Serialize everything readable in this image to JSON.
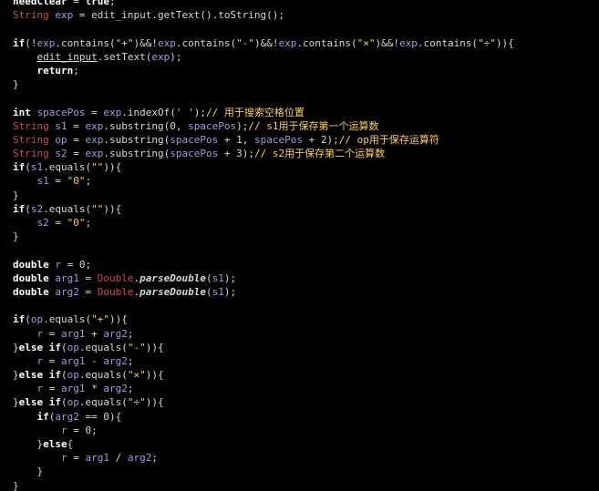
{
  "editor": {
    "lines": [
      [
        {
          "t": "kw",
          "v": "needClear"
        },
        {
          "t": "plain",
          "v": " = "
        },
        {
          "t": "kw",
          "v": "true"
        },
        {
          "t": "plain",
          "v": ";"
        }
      ],
      [
        {
          "t": "type",
          "v": "String"
        },
        {
          "t": "plain",
          "v": " "
        },
        {
          "t": "var",
          "v": "exp"
        },
        {
          "t": "plain",
          "v": " = edit_input.getText().toString();"
        }
      ],
      [],
      [
        {
          "t": "kw",
          "v": "if"
        },
        {
          "t": "plain",
          "v": "(!"
        },
        {
          "t": "var",
          "v": "exp"
        },
        {
          "t": "plain",
          "v": ".contains("
        },
        {
          "t": "str",
          "v": "\"+\""
        },
        {
          "t": "plain",
          "v": ")&&!"
        },
        {
          "t": "var",
          "v": "exp"
        },
        {
          "t": "plain",
          "v": ".contains("
        },
        {
          "t": "str",
          "v": "\"-\""
        },
        {
          "t": "plain",
          "v": ")&&!"
        },
        {
          "t": "var",
          "v": "exp"
        },
        {
          "t": "plain",
          "v": ".contains("
        },
        {
          "t": "str",
          "v": "\"×\""
        },
        {
          "t": "plain",
          "v": ")&&!"
        },
        {
          "t": "var",
          "v": "exp"
        },
        {
          "t": "plain",
          "v": ".contains("
        },
        {
          "t": "str",
          "v": "\"÷\""
        },
        {
          "t": "plain",
          "v": ")){"
        }
      ],
      [
        {
          "t": "plain",
          "v": "    "
        },
        {
          "t": "link",
          "v": "edit_input"
        },
        {
          "t": "plain",
          "v": ".setText("
        },
        {
          "t": "var",
          "v": "exp"
        },
        {
          "t": "plain",
          "v": ");"
        }
      ],
      [
        {
          "t": "plain",
          "v": "    "
        },
        {
          "t": "kw",
          "v": "return"
        },
        {
          "t": "plain",
          "v": ";"
        }
      ],
      [
        {
          "t": "plain",
          "v": "}"
        }
      ],
      [],
      [
        {
          "t": "kw",
          "v": "int"
        },
        {
          "t": "plain",
          "v": " "
        },
        {
          "t": "var",
          "v": "spacePos"
        },
        {
          "t": "plain",
          "v": " = "
        },
        {
          "t": "var",
          "v": "exp"
        },
        {
          "t": "plain",
          "v": ".indexOf("
        },
        {
          "t": "str",
          "v": "' '"
        },
        {
          "t": "plain",
          "v": ");"
        },
        {
          "t": "cmt",
          "v": "// 用于搜索空格位置"
        }
      ],
      [
        {
          "t": "type",
          "v": "String"
        },
        {
          "t": "plain",
          "v": " "
        },
        {
          "t": "var",
          "v": "s1"
        },
        {
          "t": "plain",
          "v": " = "
        },
        {
          "t": "var",
          "v": "exp"
        },
        {
          "t": "plain",
          "v": ".substring("
        },
        {
          "t": "num",
          "v": "0"
        },
        {
          "t": "plain",
          "v": ", "
        },
        {
          "t": "var",
          "v": "spacePos"
        },
        {
          "t": "plain",
          "v": ");"
        },
        {
          "t": "cmt",
          "v": "// s1用于保存第一个运算数"
        }
      ],
      [
        {
          "t": "type",
          "v": "String"
        },
        {
          "t": "plain",
          "v": " "
        },
        {
          "t": "var",
          "v": "op"
        },
        {
          "t": "plain",
          "v": " = "
        },
        {
          "t": "var",
          "v": "exp"
        },
        {
          "t": "plain",
          "v": ".substring("
        },
        {
          "t": "var",
          "v": "spacePos"
        },
        {
          "t": "plain",
          "v": " + "
        },
        {
          "t": "num",
          "v": "1"
        },
        {
          "t": "plain",
          "v": ", "
        },
        {
          "t": "var",
          "v": "spacePos"
        },
        {
          "t": "plain",
          "v": " + "
        },
        {
          "t": "num",
          "v": "2"
        },
        {
          "t": "plain",
          "v": ");"
        },
        {
          "t": "cmt",
          "v": "// op用于保存运算符"
        }
      ],
      [
        {
          "t": "type",
          "v": "String"
        },
        {
          "t": "plain",
          "v": " "
        },
        {
          "t": "var",
          "v": "s2"
        },
        {
          "t": "plain",
          "v": " = "
        },
        {
          "t": "var",
          "v": "exp"
        },
        {
          "t": "plain",
          "v": ".substring("
        },
        {
          "t": "var",
          "v": "spacePos"
        },
        {
          "t": "plain",
          "v": " + "
        },
        {
          "t": "num",
          "v": "3"
        },
        {
          "t": "plain",
          "v": ");"
        },
        {
          "t": "cmt",
          "v": "// s2用于保存第二个运算数"
        }
      ],
      [
        {
          "t": "kw",
          "v": "if"
        },
        {
          "t": "plain",
          "v": "("
        },
        {
          "t": "var",
          "v": "s1"
        },
        {
          "t": "plain",
          "v": ".equals("
        },
        {
          "t": "str",
          "v": "\"\""
        },
        {
          "t": "plain",
          "v": ")){"
        }
      ],
      [
        {
          "t": "plain",
          "v": "    "
        },
        {
          "t": "var",
          "v": "s1"
        },
        {
          "t": "plain",
          "v": " = "
        },
        {
          "t": "str",
          "v": "\"0\""
        },
        {
          "t": "plain",
          "v": ";"
        }
      ],
      [
        {
          "t": "plain",
          "v": "}"
        }
      ],
      [
        {
          "t": "kw",
          "v": "if"
        },
        {
          "t": "plain",
          "v": "("
        },
        {
          "t": "var",
          "v": "s2"
        },
        {
          "t": "plain",
          "v": ".equals("
        },
        {
          "t": "str",
          "v": "\"\""
        },
        {
          "t": "plain",
          "v": ")){"
        }
      ],
      [
        {
          "t": "plain",
          "v": "    "
        },
        {
          "t": "var",
          "v": "s2"
        },
        {
          "t": "plain",
          "v": " = "
        },
        {
          "t": "str",
          "v": "\"0\""
        },
        {
          "t": "plain",
          "v": ";"
        }
      ],
      [
        {
          "t": "plain",
          "v": "}"
        }
      ],
      [],
      [
        {
          "t": "kw",
          "v": "double"
        },
        {
          "t": "plain",
          "v": " "
        },
        {
          "t": "var",
          "v": "r"
        },
        {
          "t": "plain",
          "v": " = "
        },
        {
          "t": "num",
          "v": "0"
        },
        {
          "t": "plain",
          "v": ";"
        }
      ],
      [
        {
          "t": "kw",
          "v": "double"
        },
        {
          "t": "plain",
          "v": " "
        },
        {
          "t": "var",
          "v": "arg1"
        },
        {
          "t": "plain",
          "v": " = "
        },
        {
          "t": "type",
          "v": "Double"
        },
        {
          "t": "plain",
          "v": "."
        },
        {
          "t": "static",
          "v": "parseDouble"
        },
        {
          "t": "plain",
          "v": "("
        },
        {
          "t": "var",
          "v": "s1"
        },
        {
          "t": "plain",
          "v": ");"
        }
      ],
      [
        {
          "t": "kw",
          "v": "double"
        },
        {
          "t": "plain",
          "v": " "
        },
        {
          "t": "var",
          "v": "arg2"
        },
        {
          "t": "plain",
          "v": " = "
        },
        {
          "t": "type",
          "v": "Double"
        },
        {
          "t": "plain",
          "v": "."
        },
        {
          "t": "static",
          "v": "parseDouble"
        },
        {
          "t": "plain",
          "v": "("
        },
        {
          "t": "var",
          "v": "s1"
        },
        {
          "t": "plain",
          "v": ");"
        }
      ],
      [],
      [
        {
          "t": "kw",
          "v": "if"
        },
        {
          "t": "plain",
          "v": "("
        },
        {
          "t": "var",
          "v": "op"
        },
        {
          "t": "plain",
          "v": ".equals("
        },
        {
          "t": "str",
          "v": "\"+\""
        },
        {
          "t": "plain",
          "v": ")){"
        }
      ],
      [
        {
          "t": "plain",
          "v": "    "
        },
        {
          "t": "var",
          "v": "r"
        },
        {
          "t": "plain",
          "v": " = "
        },
        {
          "t": "var",
          "v": "arg1"
        },
        {
          "t": "plain",
          "v": " + "
        },
        {
          "t": "var",
          "v": "arg2"
        },
        {
          "t": "plain",
          "v": ";"
        }
      ],
      [
        {
          "t": "plain",
          "v": "}"
        },
        {
          "t": "kw",
          "v": "else if"
        },
        {
          "t": "plain",
          "v": "("
        },
        {
          "t": "var",
          "v": "op"
        },
        {
          "t": "plain",
          "v": ".equals("
        },
        {
          "t": "str",
          "v": "\"-\""
        },
        {
          "t": "plain",
          "v": ")){"
        }
      ],
      [
        {
          "t": "plain",
          "v": "    "
        },
        {
          "t": "var",
          "v": "r"
        },
        {
          "t": "plain",
          "v": " = "
        },
        {
          "t": "var",
          "v": "arg1"
        },
        {
          "t": "plain",
          "v": " - "
        },
        {
          "t": "var",
          "v": "arg2"
        },
        {
          "t": "plain",
          "v": ";"
        }
      ],
      [
        {
          "t": "plain",
          "v": "}"
        },
        {
          "t": "kw",
          "v": "else if"
        },
        {
          "t": "plain",
          "v": "("
        },
        {
          "t": "var",
          "v": "op"
        },
        {
          "t": "plain",
          "v": ".equals("
        },
        {
          "t": "str",
          "v": "\"×\""
        },
        {
          "t": "plain",
          "v": ")){"
        }
      ],
      [
        {
          "t": "plain",
          "v": "    "
        },
        {
          "t": "var",
          "v": "r"
        },
        {
          "t": "plain",
          "v": " = "
        },
        {
          "t": "var",
          "v": "arg1"
        },
        {
          "t": "plain",
          "v": " * "
        },
        {
          "t": "var",
          "v": "arg2"
        },
        {
          "t": "plain",
          "v": ";"
        }
      ],
      [
        {
          "t": "plain",
          "v": "}"
        },
        {
          "t": "kw",
          "v": "else if"
        },
        {
          "t": "plain",
          "v": "("
        },
        {
          "t": "var",
          "v": "op"
        },
        {
          "t": "plain",
          "v": ".equals("
        },
        {
          "t": "str",
          "v": "\"÷\""
        },
        {
          "t": "plain",
          "v": ")){"
        }
      ],
      [
        {
          "t": "plain",
          "v": "    "
        },
        {
          "t": "kw",
          "v": "if"
        },
        {
          "t": "plain",
          "v": "("
        },
        {
          "t": "var",
          "v": "arg2"
        },
        {
          "t": "plain",
          "v": " == "
        },
        {
          "t": "num",
          "v": "0"
        },
        {
          "t": "plain",
          "v": "){"
        }
      ],
      [
        {
          "t": "plain",
          "v": "        "
        },
        {
          "t": "var",
          "v": "r"
        },
        {
          "t": "plain",
          "v": " = "
        },
        {
          "t": "num",
          "v": "0"
        },
        {
          "t": "plain",
          "v": ";"
        }
      ],
      [
        {
          "t": "plain",
          "v": "    }"
        },
        {
          "t": "kw",
          "v": "else"
        },
        {
          "t": "plain",
          "v": "{"
        }
      ],
      [
        {
          "t": "plain",
          "v": "        "
        },
        {
          "t": "var",
          "v": "r"
        },
        {
          "t": "plain",
          "v": " = "
        },
        {
          "t": "var",
          "v": "arg1"
        },
        {
          "t": "plain",
          "v": " / "
        },
        {
          "t": "var",
          "v": "arg2"
        },
        {
          "t": "plain",
          "v": ";"
        }
      ],
      [
        {
          "t": "plain",
          "v": "    }"
        }
      ],
      [
        {
          "t": "plain",
          "v": "}"
        }
      ]
    ]
  },
  "colors": {
    "background": "#000000",
    "keyword": "#ffffff",
    "type": "#d14b4b",
    "variable": "#9b9fe3",
    "string": "#ffd24a",
    "comment": "#ffd24a",
    "plain": "#d8d8d8"
  }
}
